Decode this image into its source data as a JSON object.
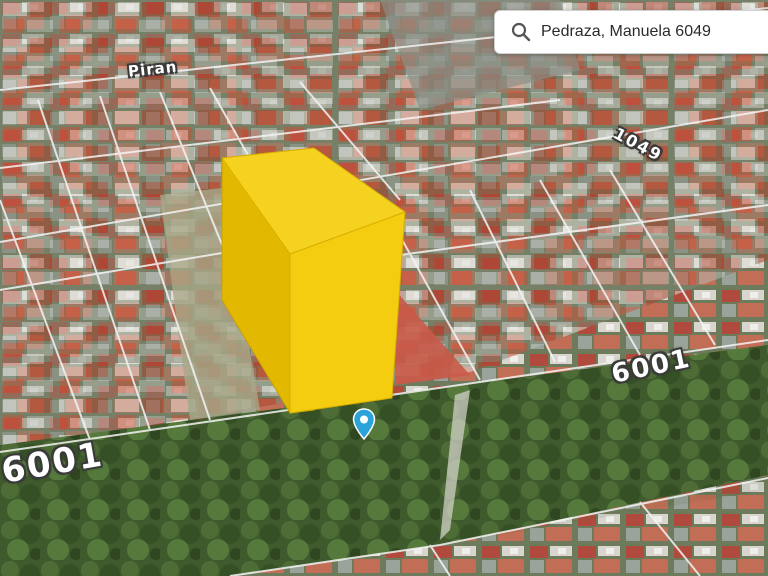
{
  "search": {
    "value": "Pedraza, Manuela 6049",
    "icon": "search-icon"
  },
  "map": {
    "street_labels": {
      "left": "6001",
      "right": "6001",
      "top": "Piran",
      "top_right": "1049"
    },
    "building_color": "#f2c500",
    "pin_color": "#2ba3d9",
    "pin_icon": "location-pin-icon"
  }
}
